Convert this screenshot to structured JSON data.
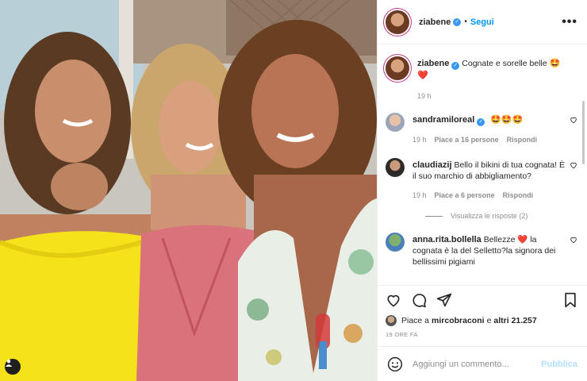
{
  "post": {
    "author": "ziabene",
    "follow_label": "Segui",
    "separator": "•",
    "more_label": "•••"
  },
  "caption": {
    "user": "ziabene",
    "text": "Cognate e sorelle belle",
    "emojis": "🤩 ❤️",
    "time": "19 h"
  },
  "comments": [
    {
      "user": "sandramiloreal",
      "verified": true,
      "text": "🤩🤩🤩",
      "time": "19 h",
      "likes": "Piace a 16 persone",
      "reply": "Rispondi"
    },
    {
      "user": "claudiazij",
      "verified": false,
      "text": "Bello il bikini di tua cognata! È il suo marchio di abbigliamento?",
      "time": "19 h",
      "likes": "Piace a 6 persone",
      "reply": "Rispondi"
    },
    {
      "user": "anna.rita.bollella",
      "verified": false,
      "text": "Bellezze ❤️ la cognata è la del Selletto?la signora dei bellissimi pigiami",
      "time": "",
      "likes": "",
      "reply": ""
    }
  ],
  "view_replies": "Visualizza le risposte (2)",
  "likes_line": {
    "prefix": "Piace a ",
    "user": "mircobraconi",
    "middle": " e ",
    "others": "altri 21.257"
  },
  "post_time": "19 ORE FA",
  "add_comment": {
    "placeholder": "Aggiungi un commento...",
    "publish": "Pubblica"
  },
  "colors": {
    "accent": "#0095f6",
    "verified": "#3897f0",
    "heart_red": "#ed4956",
    "yellow_top": "#f5e21a",
    "pink_top": "#d9727a"
  },
  "icons": [
    "verified-icon",
    "more-icon",
    "like-icon",
    "comment-icon",
    "share-icon",
    "save-icon",
    "emoji-icon",
    "user-tag-icon"
  ]
}
